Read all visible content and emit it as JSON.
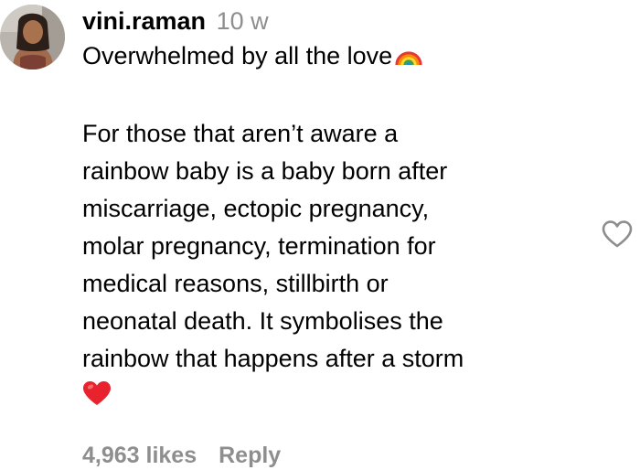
{
  "comment": {
    "username": "vini.raman",
    "time": "10 w",
    "lines": [
      "Overwhelmed by all the love",
      "",
      "For those that aren’t aware a",
      "rainbow baby is a baby born after",
      "miscarriage, ectopic pregnancy,",
      "molar pregnancy, termination for",
      "medical reasons, stillbirth or",
      "neonatal death. It symbolises the",
      "rainbow that happens after a storm"
    ],
    "emoji_1": "rainbow-emoji",
    "emoji_2": "red-heart-emoji",
    "likes": "4,963 likes",
    "reply_label": "Reply",
    "like_icon": "heart-outline-icon"
  },
  "colors": {
    "text": "#000000",
    "muted": "#8e8e8e",
    "heart_emoji": "#e8232d",
    "like_icon_stroke": "#8e8e8e"
  }
}
